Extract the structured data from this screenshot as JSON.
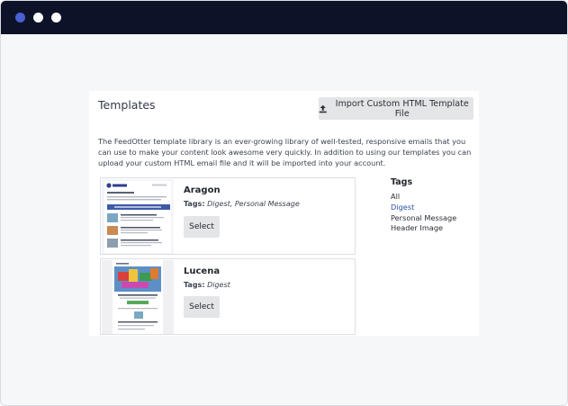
{
  "window": {
    "controls": [
      "close",
      "minimize",
      "maximize"
    ]
  },
  "panel": {
    "title": "Templates",
    "import_button": {
      "label": "Import Custom HTML Template File",
      "icon": "upload-icon"
    },
    "description": "The FeedOtter template library is an ever-growing library of well-tested, responsive emails that you can use to make your content look awesome very quickly. In addition to using our templates you can upload your custom HTML email file and it will be imported into your account."
  },
  "templates": [
    {
      "name": "Aragon",
      "tags_label": "Tags:",
      "tags": "Digest, Personal Message",
      "select_label": "Select",
      "thumb_brand": "feedotter"
    },
    {
      "name": "Lucena",
      "tags_label": "Tags:",
      "tags": "Digest",
      "select_label": "Select"
    }
  ],
  "tag_filter": {
    "heading": "Tags",
    "items": [
      {
        "label": "All",
        "active": false
      },
      {
        "label": "Digest",
        "active": true
      },
      {
        "label": "Personal Message",
        "active": false
      },
      {
        "label": "Header Image",
        "active": false
      }
    ]
  },
  "colors": {
    "titlebar": "#0d1229",
    "accent": "#4a5fd1",
    "button_bg": "#e4e5e7",
    "active_tag": "#2e4fa8"
  }
}
